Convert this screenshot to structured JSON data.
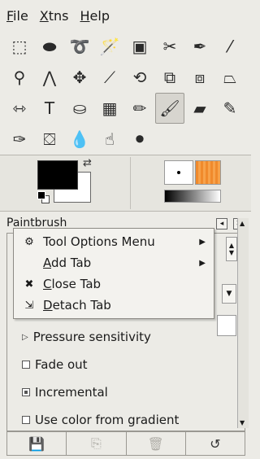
{
  "menubar": {
    "items": [
      {
        "label": "File",
        "mnemonic": "F",
        "rest": "ile"
      },
      {
        "label": "Xtns",
        "mnemonic": "X",
        "rest": "tns"
      },
      {
        "label": "Help",
        "mnemonic": "H",
        "rest": "elp"
      }
    ]
  },
  "tools": [
    {
      "icon": "rect-select-icon",
      "glyph": "⬚"
    },
    {
      "icon": "ellipse-select-icon",
      "glyph": "⬬"
    },
    {
      "icon": "free-select-icon",
      "glyph": "➰"
    },
    {
      "icon": "fuzzy-select-icon",
      "glyph": "🪄"
    },
    {
      "icon": "select-by-color-icon",
      "glyph": "▣"
    },
    {
      "icon": "scissors-select-icon",
      "glyph": "✂"
    },
    {
      "icon": "paths-icon",
      "glyph": "✒"
    },
    {
      "icon": "color-picker-icon",
      "glyph": "⁄"
    },
    {
      "icon": "zoom-icon",
      "glyph": "⚲"
    },
    {
      "icon": "measure-icon",
      "glyph": "⋀"
    },
    {
      "icon": "move-icon",
      "glyph": "✥"
    },
    {
      "icon": "crop-icon",
      "glyph": "⟋"
    },
    {
      "icon": "rotate-icon",
      "glyph": "⟲"
    },
    {
      "icon": "scale-icon",
      "glyph": "⧉"
    },
    {
      "icon": "shear-icon",
      "glyph": "⧈"
    },
    {
      "icon": "perspective-icon",
      "glyph": "⏢"
    },
    {
      "icon": "flip-icon",
      "glyph": "⇿"
    },
    {
      "icon": "text-icon",
      "glyph": "T"
    },
    {
      "icon": "bucket-fill-icon",
      "glyph": "⛀"
    },
    {
      "icon": "blend-icon",
      "glyph": "▦"
    },
    {
      "icon": "pencil-icon",
      "glyph": "✏"
    },
    {
      "icon": "paintbrush-icon",
      "glyph": "🖌"
    },
    {
      "icon": "eraser-icon",
      "glyph": "▰"
    },
    {
      "icon": "airbrush-icon",
      "glyph": "✎"
    },
    {
      "icon": "ink-icon",
      "glyph": "✑"
    },
    {
      "icon": "clone-icon",
      "glyph": "⛋"
    },
    {
      "icon": "blur-sharpen-icon",
      "glyph": "💧"
    },
    {
      "icon": "smudge-icon",
      "glyph": "☝"
    },
    {
      "icon": "dodge-burn-icon",
      "glyph": "⚫"
    }
  ],
  "active_tool_index": 21,
  "colors": {
    "foreground": "#000000",
    "background": "#ffffff",
    "pattern_color": "#f08a2c"
  },
  "dock": {
    "title": "Paintbrush",
    "left_letters": [
      "I",
      "I"
    ]
  },
  "context_menu": {
    "items": [
      {
        "icon": "tool-options-icon",
        "glyph": "⚙",
        "mnemonic": "",
        "label": "Tool Options Menu",
        "has_submenu": true
      },
      {
        "icon": "",
        "glyph": "",
        "mnemonic": "A",
        "rest": "dd Tab",
        "label": "Add Tab",
        "has_submenu": true
      },
      {
        "icon": "close-icon",
        "glyph": "✖",
        "mnemonic": "C",
        "rest": "lose Tab",
        "label": "Close Tab",
        "has_submenu": false
      },
      {
        "icon": "detach-icon",
        "glyph": "⇲",
        "mnemonic": "D",
        "rest": "etach Tab",
        "label": "Detach Tab",
        "has_submenu": false
      }
    ]
  },
  "options": {
    "pressure": "Pressure sensitivity",
    "fade": "Fade out",
    "incremental": "Incremental",
    "gradient": "Use color from gradient"
  },
  "option_states": {
    "fade": false,
    "incremental": true,
    "gradient": false
  },
  "bottom_buttons": [
    {
      "icon": "save-options-icon",
      "glyph": "💾",
      "enabled": true
    },
    {
      "icon": "restore-options-icon",
      "glyph": "⎘",
      "enabled": false
    },
    {
      "icon": "delete-options-icon",
      "glyph": "🗑",
      "enabled": false
    },
    {
      "icon": "reset-options-icon",
      "glyph": "↺",
      "enabled": true
    }
  ]
}
